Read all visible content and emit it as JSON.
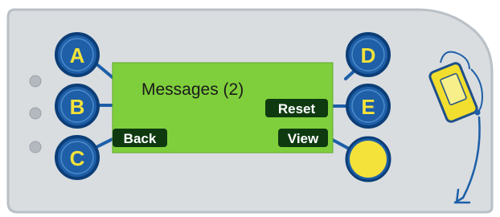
{
  "screen": {
    "title": "Messages (2)",
    "softkeys": {
      "left_bottom": "Back",
      "right_middle": "Reset",
      "right_bottom": "View"
    }
  },
  "buttons": {
    "a": "A",
    "b": "B",
    "c": "C",
    "d": "D",
    "e": "E"
  },
  "indicators": [
    {
      "name": "led-1"
    },
    {
      "name": "led-2"
    },
    {
      "name": "led-3"
    }
  ],
  "icons": {
    "device_tag": "handheld-tag-icon",
    "arrow": "down-left-arrow-icon"
  },
  "colors": {
    "panel": "#d9dde0",
    "panel_edge": "#b9c0c6",
    "lcd": "#7fcf3c",
    "button_fill": "#1e5fa8",
    "button_ring": "#0c3e78",
    "connector": "#1e5fa8",
    "yellow_button": "#f4e23a",
    "softkey_bg": "#0f3a10",
    "softkey_text": "#ffffff",
    "lcd_text": "#1a1a1a"
  }
}
